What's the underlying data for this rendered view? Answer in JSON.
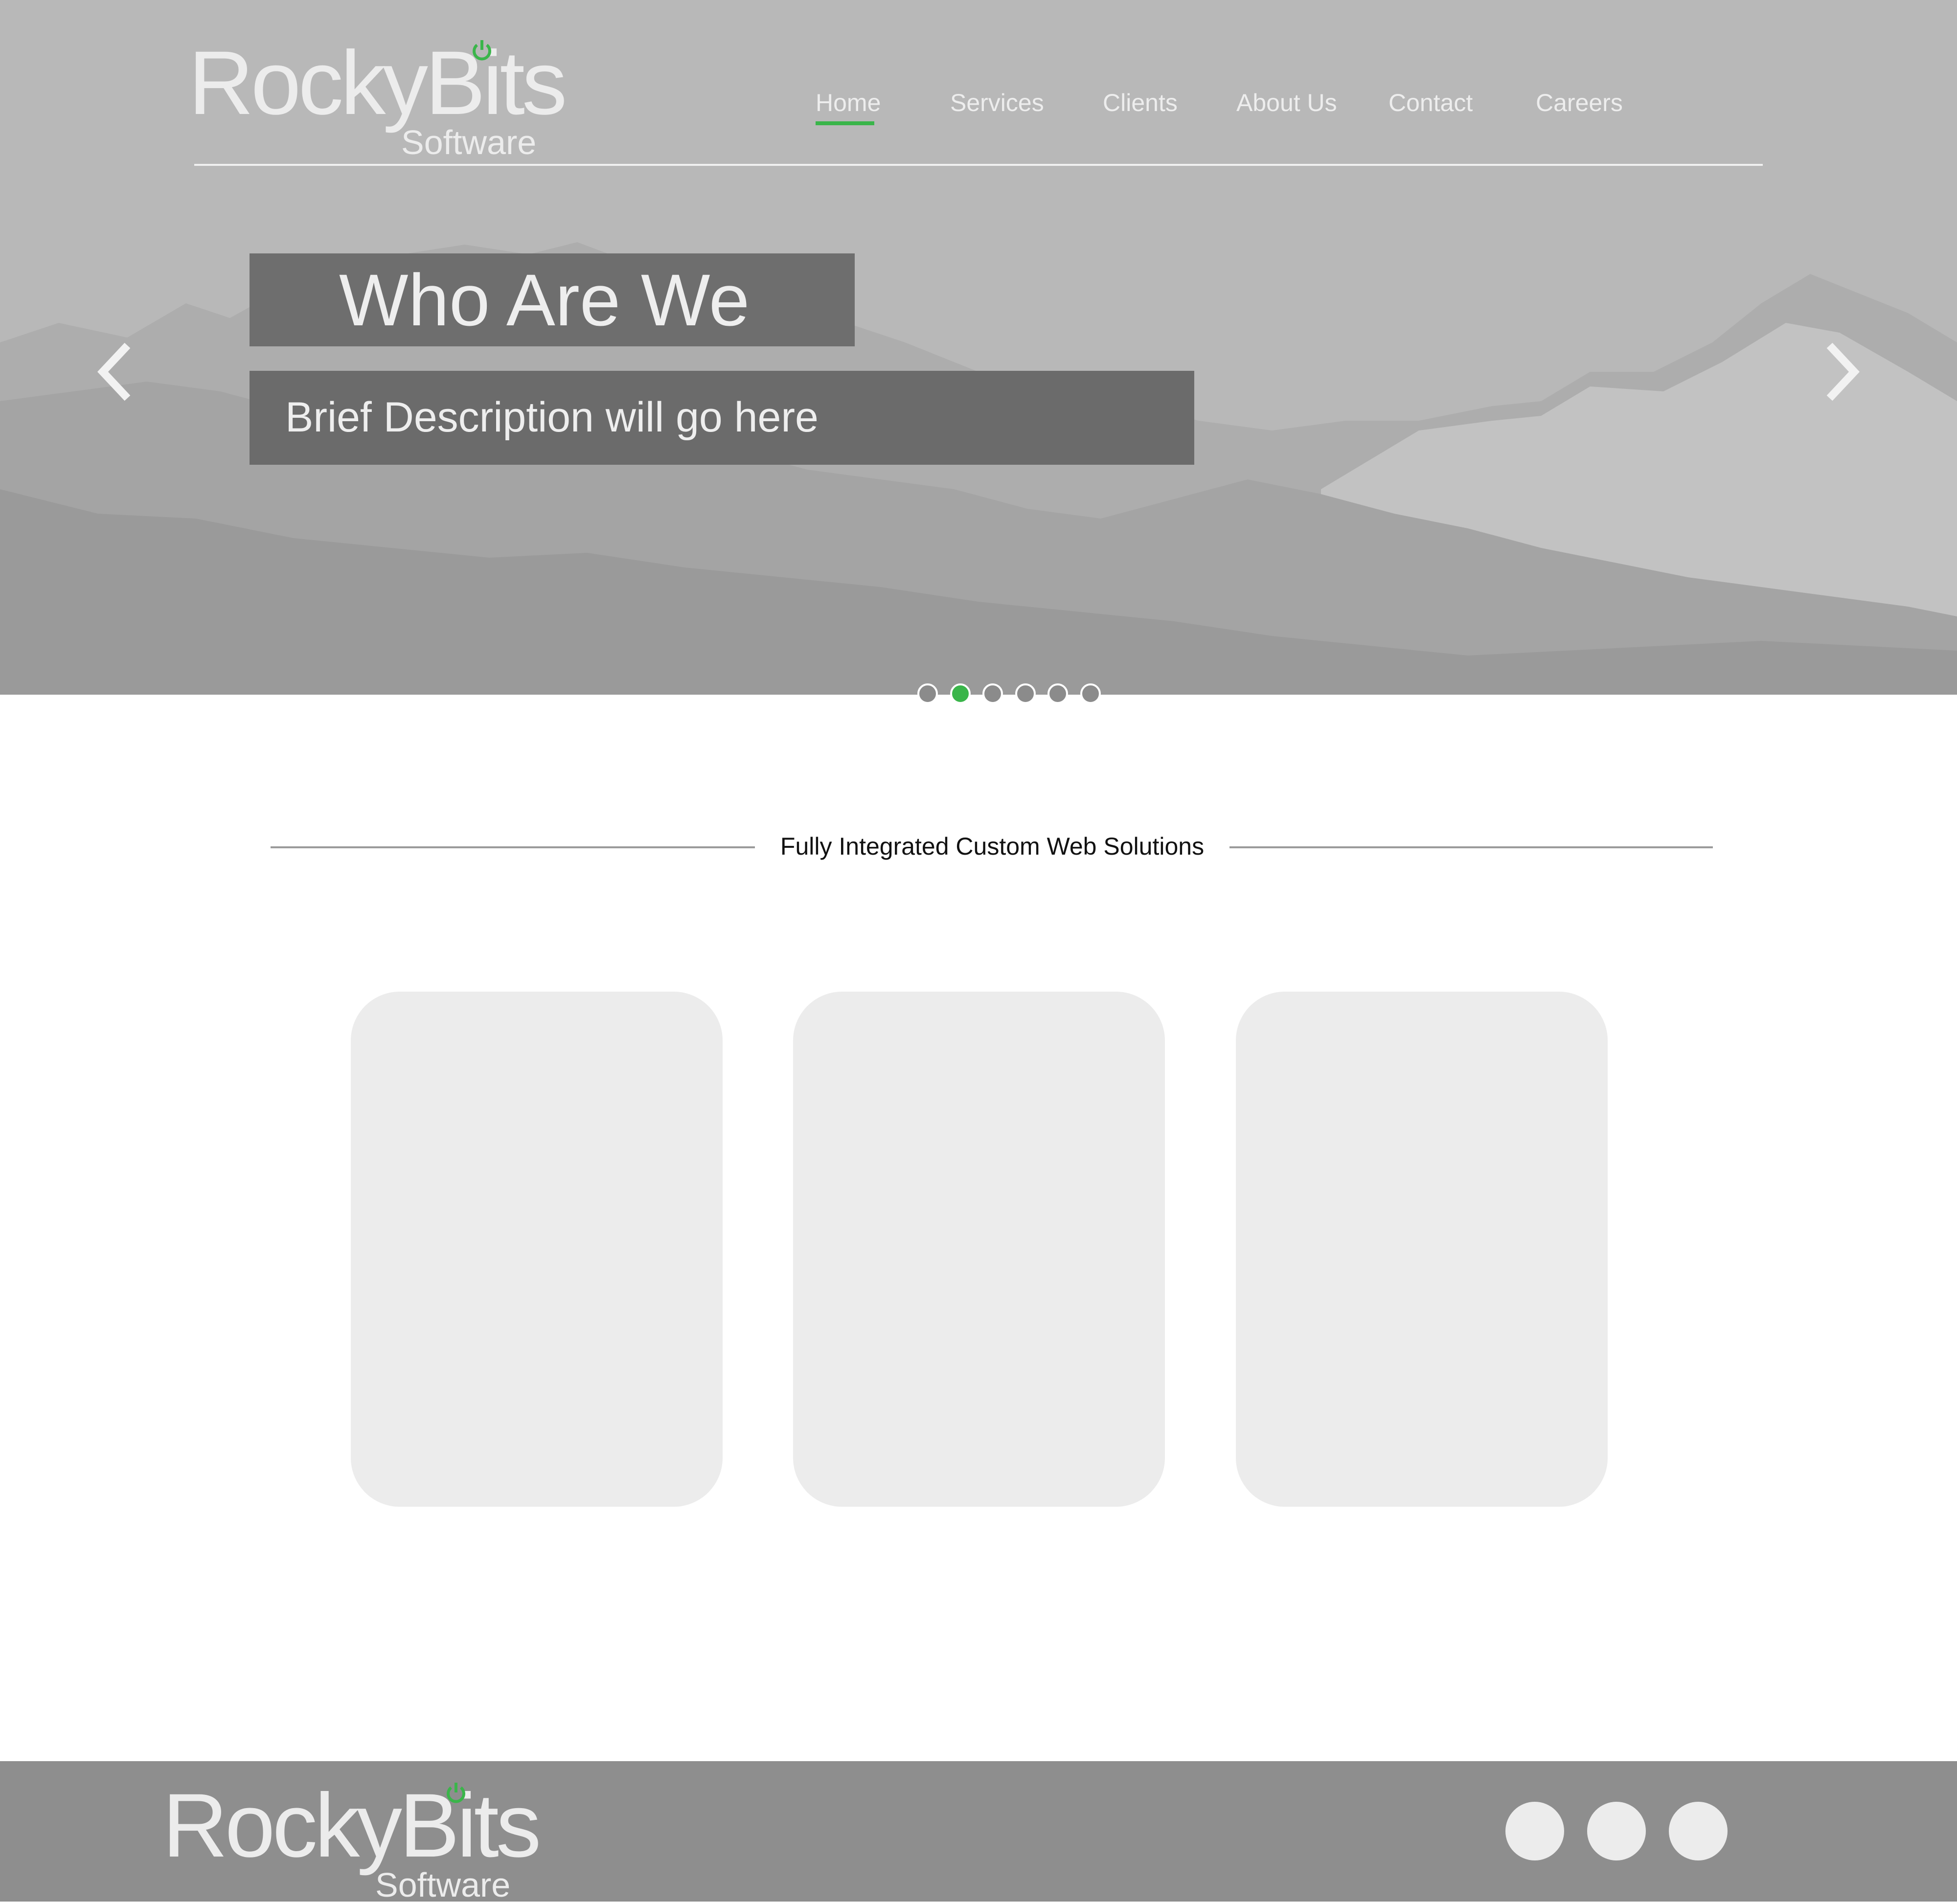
{
  "brand": {
    "name": "RockyBits",
    "tagline": "Software",
    "accent_color": "#3ab54a"
  },
  "nav": {
    "items": [
      {
        "label": "Home",
        "active": true
      },
      {
        "label": "Services",
        "active": false
      },
      {
        "label": "Clients",
        "active": false
      },
      {
        "label": "About Us",
        "active": false
      },
      {
        "label": "Contact",
        "active": false
      },
      {
        "label": "Careers",
        "active": false
      }
    ]
  },
  "hero": {
    "title": "Who  Are We",
    "description": "Brief Description will go here",
    "prev_icon": "chevron-left-icon",
    "next_icon": "chevron-right-icon",
    "slides_total": 6,
    "active_slide": 2
  },
  "section": {
    "title": "Fully Integrated Custom Web Solutions",
    "cards": [
      {
        "label": ""
      },
      {
        "label": ""
      },
      {
        "label": ""
      }
    ]
  },
  "footer": {
    "brand_name": "RockyBits",
    "brand_tagline": "Software",
    "social_icons": [
      "social-icon-1",
      "social-icon-2",
      "social-icon-3"
    ]
  }
}
